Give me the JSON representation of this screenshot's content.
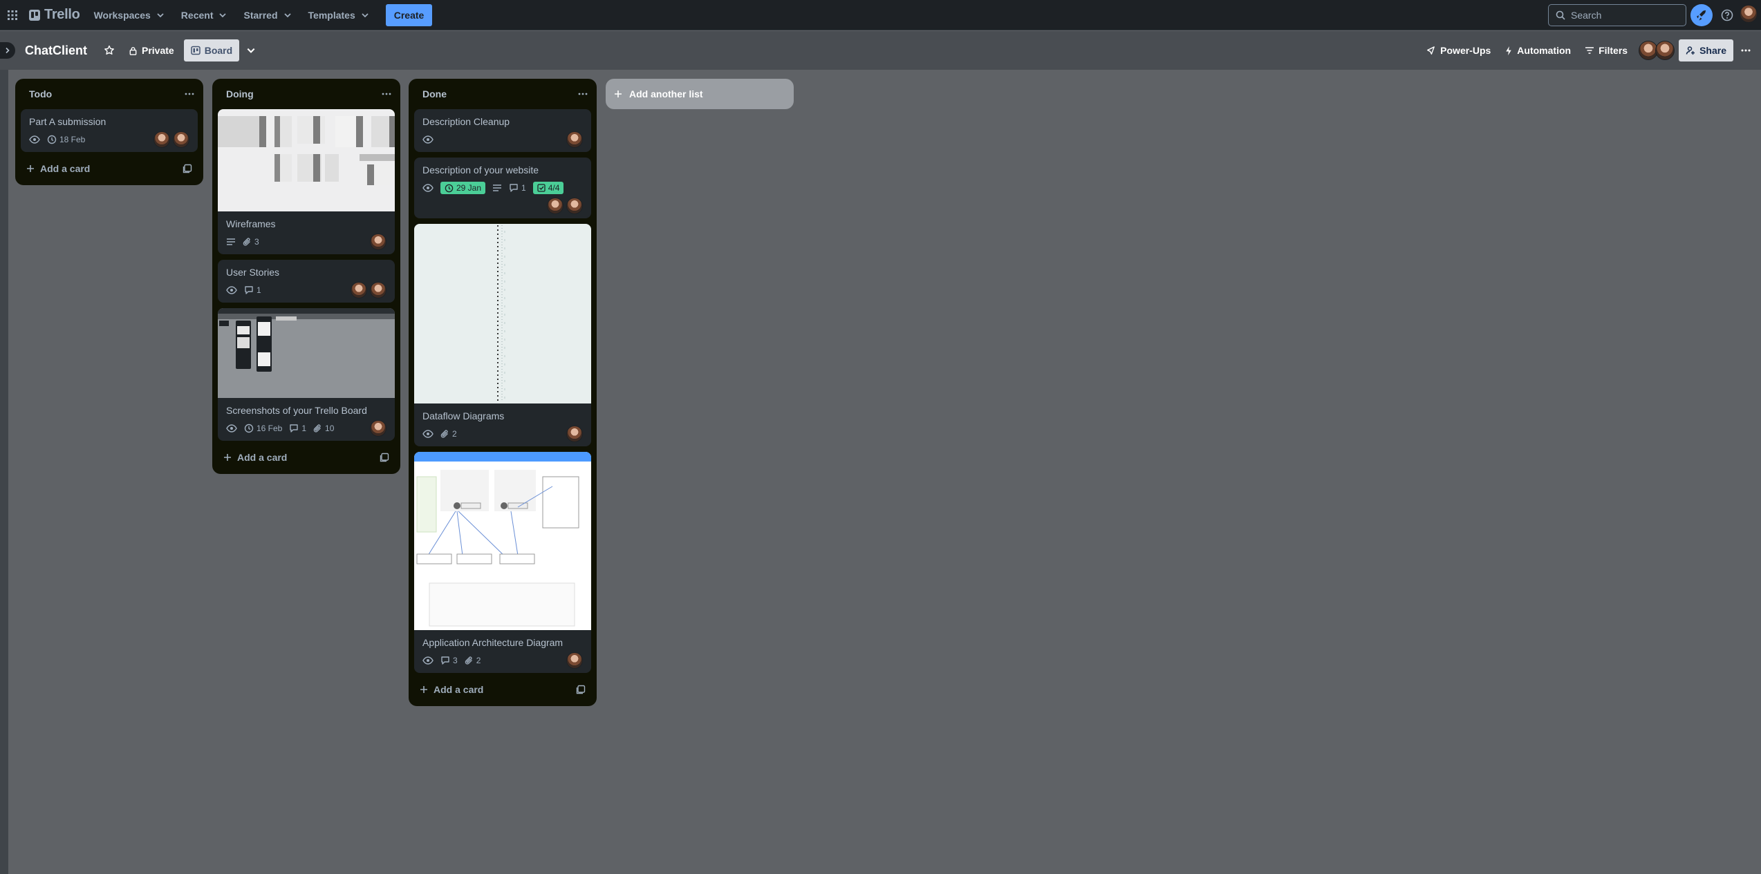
{
  "nav": {
    "brand": "Trello",
    "workspaces": "Workspaces",
    "recent": "Recent",
    "starred": "Starred",
    "templates": "Templates",
    "create": "Create",
    "search_placeholder": "Search"
  },
  "board": {
    "title": "ChatClient",
    "visibility": "Private",
    "view": "Board",
    "power_ups": "Power-Ups",
    "automation": "Automation",
    "filters": "Filters",
    "share": "Share"
  },
  "lists": [
    {
      "name": "Todo",
      "add_card": "Add a card",
      "cards": [
        {
          "title": "Part A submission",
          "due": "18 Feb"
        }
      ]
    },
    {
      "name": "Doing",
      "add_card": "Add a card",
      "cards": [
        {
          "title": "Wireframes",
          "attachments": "3"
        },
        {
          "title": "User Stories",
          "comments": "1"
        },
        {
          "title": "Screenshots of your Trello Board",
          "due": "16 Feb",
          "comments": "1",
          "attachments": "10"
        }
      ]
    },
    {
      "name": "Done",
      "add_card": "Add a card",
      "cards": [
        {
          "title": "Description Cleanup"
        },
        {
          "title": "Description of your website",
          "due": "29 Jan",
          "comments": "1",
          "checklist": "4/4"
        },
        {
          "title": "Dataflow Diagrams",
          "attachments": "2"
        },
        {
          "title": "Application Architecture Diagram",
          "comments": "3",
          "attachments": "2"
        }
      ]
    }
  ],
  "add_list": "Add another list",
  "colors": {
    "nav_bg": "#1d2125",
    "board_bg": "#5f6266",
    "list_bg": "#101204",
    "card_bg": "#22272b",
    "accent": "#579dff",
    "complete_green": "#4bce97"
  },
  "icons": [
    "app-grid-icon",
    "trello-logo-icon",
    "chevron-down-icon",
    "search-icon",
    "rocket-icon",
    "help-icon",
    "star-icon",
    "lock-icon",
    "board-icon",
    "power-ups-icon",
    "lightning-icon",
    "filter-icon",
    "share-icon",
    "more-icon",
    "eye-icon",
    "clock-icon",
    "description-icon",
    "comment-icon",
    "paperclip-icon",
    "checklist-icon",
    "plus-icon",
    "template-icon"
  ]
}
